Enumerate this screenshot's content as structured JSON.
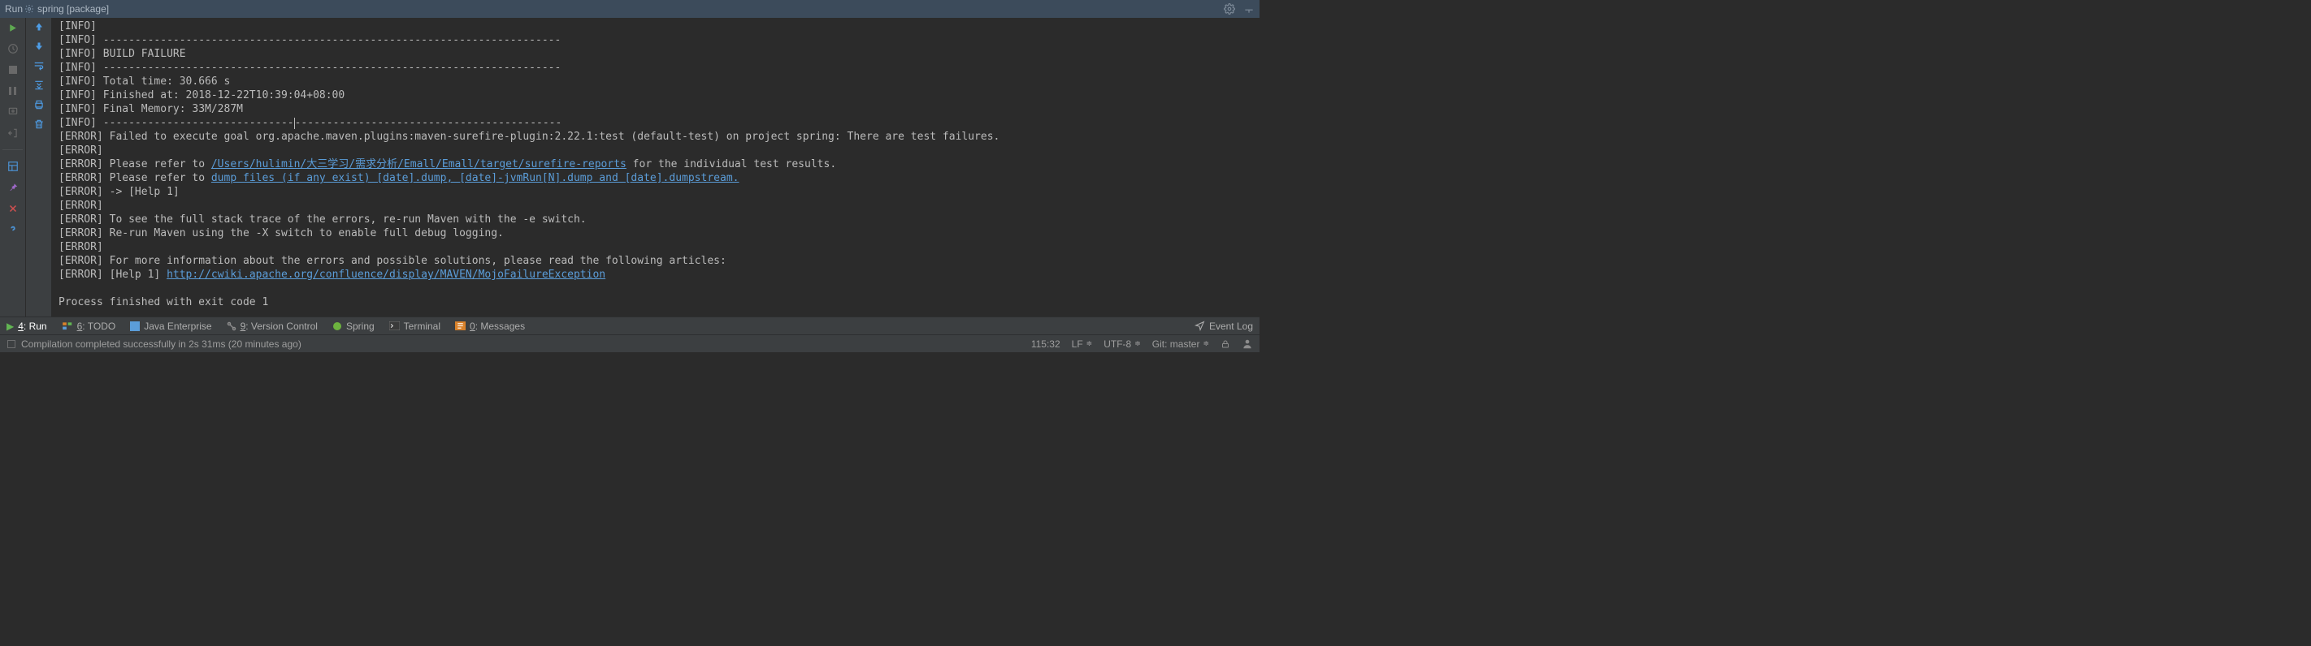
{
  "titlebar": {
    "run": "Run",
    "config": "spring [package]"
  },
  "console_lines": [
    {
      "prefix": "[INFO] ",
      "text": ""
    },
    {
      "prefix": "[INFO] ",
      "text": "------------------------------------------------------------------------"
    },
    {
      "prefix": "[INFO] ",
      "text": "BUILD FAILURE"
    },
    {
      "prefix": "[INFO] ",
      "text": "------------------------------------------------------------------------"
    },
    {
      "prefix": "[INFO] ",
      "text": "Total time: 30.666 s"
    },
    {
      "prefix": "[INFO] ",
      "text": "Finished at: 2018-12-22T10:39:04+08:00"
    },
    {
      "prefix": "[INFO] ",
      "text": "Final Memory: 33M/287M"
    },
    {
      "prefix": "[INFO] ",
      "text": "------------------------------",
      "caret": true,
      "text2": "------------------------------------------"
    },
    {
      "prefix": "[ERROR] ",
      "text": "Failed to execute goal org.apache.maven.plugins:maven-surefire-plugin:2.22.1:test (default-test) on project spring: There are test failures."
    },
    {
      "prefix": "[ERROR] ",
      "text": ""
    },
    {
      "prefix": "[ERROR] ",
      "text": "Please refer to ",
      "link": "/Users/hulimin/大三学习/需求分析/Emall/Emall/target/surefire-reports",
      "text2": " for the individual test results."
    },
    {
      "prefix": "[ERROR] ",
      "text": "Please refer to ",
      "link": "dump files (if any exist) [date].dump, [date]-jvmRun[N].dump and [date].dumpstream."
    },
    {
      "prefix": "[ERROR] ",
      "text": "-> [Help 1]"
    },
    {
      "prefix": "[ERROR] ",
      "text": ""
    },
    {
      "prefix": "[ERROR] ",
      "text": "To see the full stack trace of the errors, re-run Maven with the -e switch."
    },
    {
      "prefix": "[ERROR] ",
      "text": "Re-run Maven using the -X switch to enable full debug logging."
    },
    {
      "prefix": "[ERROR] ",
      "text": ""
    },
    {
      "prefix": "[ERROR] ",
      "text": "For more information about the errors and possible solutions, please read the following articles:"
    },
    {
      "prefix": "[ERROR] ",
      "text": "[Help 1] ",
      "link": "http://cwiki.apache.org/confluence/display/MAVEN/MojoFailureException"
    },
    {
      "prefix": "",
      "text": ""
    },
    {
      "prefix": "",
      "text": "Process finished with exit code 1"
    }
  ],
  "bottombar": {
    "run": {
      "num": "4",
      "label": ": Run"
    },
    "todo": {
      "num": "6",
      "label": ": TODO"
    },
    "java": "Java Enterprise",
    "vcs": {
      "num": "9",
      "label": ": Version Control"
    },
    "spring": "Spring",
    "terminal": "Terminal",
    "messages": {
      "num": "0",
      "label": ": Messages"
    },
    "eventlog": "Event Log"
  },
  "statusbar": {
    "msg": "Compilation completed successfully in 2s 31ms (20 minutes ago)",
    "pos": "115:32",
    "lineend": "LF",
    "enc": "UTF-8",
    "git": "Git: master"
  }
}
